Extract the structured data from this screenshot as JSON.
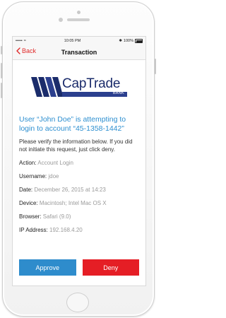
{
  "status_bar": {
    "carrier": "•••••",
    "wifi": "≈",
    "time": "10:05 PM",
    "bluetooth": "✱",
    "battery": "100%"
  },
  "nav": {
    "back_label": "Back",
    "title": "Transaction"
  },
  "logo": {
    "name": "CapTrade",
    "sub": "BANK",
    "colors": {
      "primary": "#1b2c6b",
      "accent": "#2b3f8e"
    }
  },
  "message": {
    "headline": "User “John Doe” is attempting to login to account “45-1358-1442”",
    "intro": "Please verify the information below. If you did not initiate this request, just click deny."
  },
  "details": [
    {
      "label": "Action:",
      "value": "Account Login"
    },
    {
      "label": "Username:",
      "value": "jdoe"
    },
    {
      "label": "Date:",
      "value": "December 26, 2015 at 14:23"
    },
    {
      "label": "Device:",
      "value": "Macintosh; Intel Mac OS X"
    },
    {
      "label": "Browser:",
      "value": "Safari (9.0)"
    },
    {
      "label": "IP Address:",
      "value": "192.168.4.20"
    }
  ],
  "actions": {
    "approve_label": "Approve",
    "deny_label": "Deny",
    "approve_color": "#2e8ccc",
    "deny_color": "#e51e25"
  }
}
